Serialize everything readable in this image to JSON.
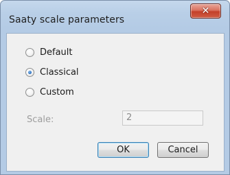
{
  "window": {
    "title": "Saaty scale parameters",
    "close_symbol": "✕"
  },
  "options": [
    {
      "label": "Default",
      "checked": false
    },
    {
      "label": "Classical",
      "checked": true
    },
    {
      "label": "Custom",
      "checked": false
    }
  ],
  "scale": {
    "label": "Scale:",
    "value": "2",
    "enabled": false
  },
  "buttons": {
    "ok_label": "OK",
    "cancel_label": "Cancel"
  },
  "colors": {
    "frame": "#b4cbe5",
    "close_button": "#c4402a",
    "client_bg": "#f0f0f0",
    "radio_dot": "#2d72c2",
    "disabled_text": "#9d9d9d"
  },
  "icons": {
    "close": "close-icon",
    "radio_selected": "radio-selected-icon",
    "radio_unselected": "radio-unselected-icon"
  }
}
